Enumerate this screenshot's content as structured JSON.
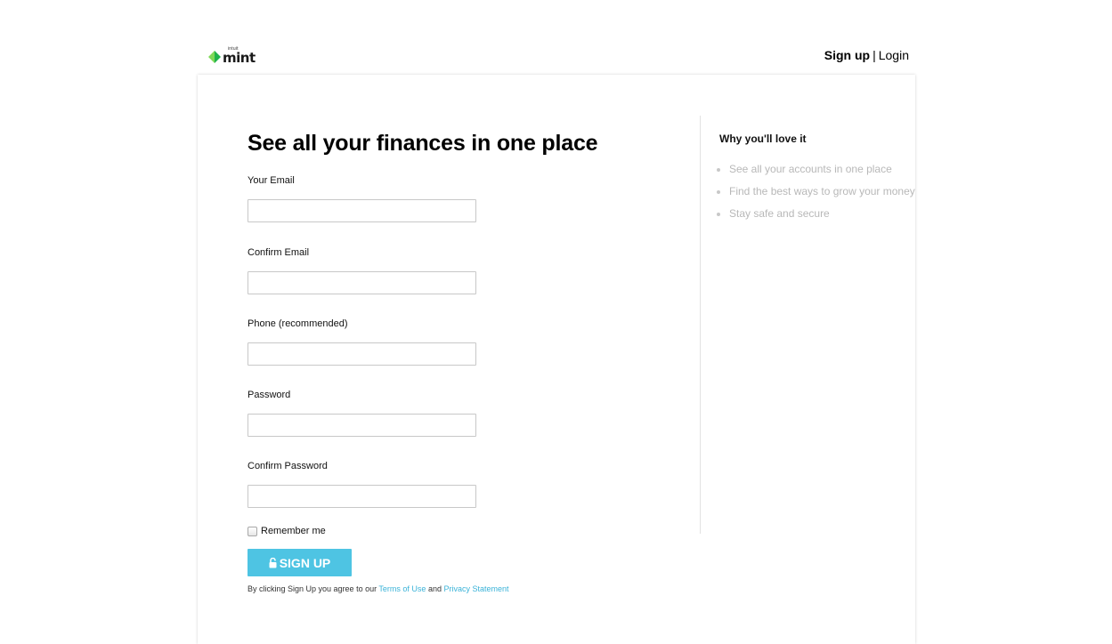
{
  "header": {
    "logo": {
      "brand_small": "intuit",
      "brand": "mint",
      "colors": {
        "leaf_light": "#7ed957",
        "leaf_dark": "#1fb34a"
      }
    },
    "signup_link": "Sign up",
    "separator": "|",
    "login_link": "Login"
  },
  "form": {
    "title": "See all your finances in one place",
    "fields": [
      {
        "label": "Your Email",
        "value": "",
        "placeholder": ""
      },
      {
        "label": "Confirm Email",
        "value": "",
        "placeholder": ""
      },
      {
        "label": "Phone (recommended)",
        "value": "",
        "placeholder": ""
      },
      {
        "label": "Password",
        "value": "",
        "placeholder": ""
      },
      {
        "label": "Confirm Password",
        "value": "",
        "placeholder": ""
      }
    ],
    "remember_me": {
      "label": "Remember me",
      "checked": false
    },
    "submit": {
      "label": "SIGN UP",
      "icon": "lock-open-icon",
      "color": "#4ec4e3"
    },
    "terms": {
      "prefix": "By clicking Sign Up you agree to our",
      "terms_link": "Terms of Use",
      "conjunction": "and",
      "privacy_link": "Privacy Statement",
      "link_color": "#3bb3d8"
    }
  },
  "sidebar": {
    "title": "Why you'll love it",
    "benefits": [
      "See all your accounts in one place",
      "Find the best ways to grow your money",
      "Stay safe and secure"
    ]
  }
}
